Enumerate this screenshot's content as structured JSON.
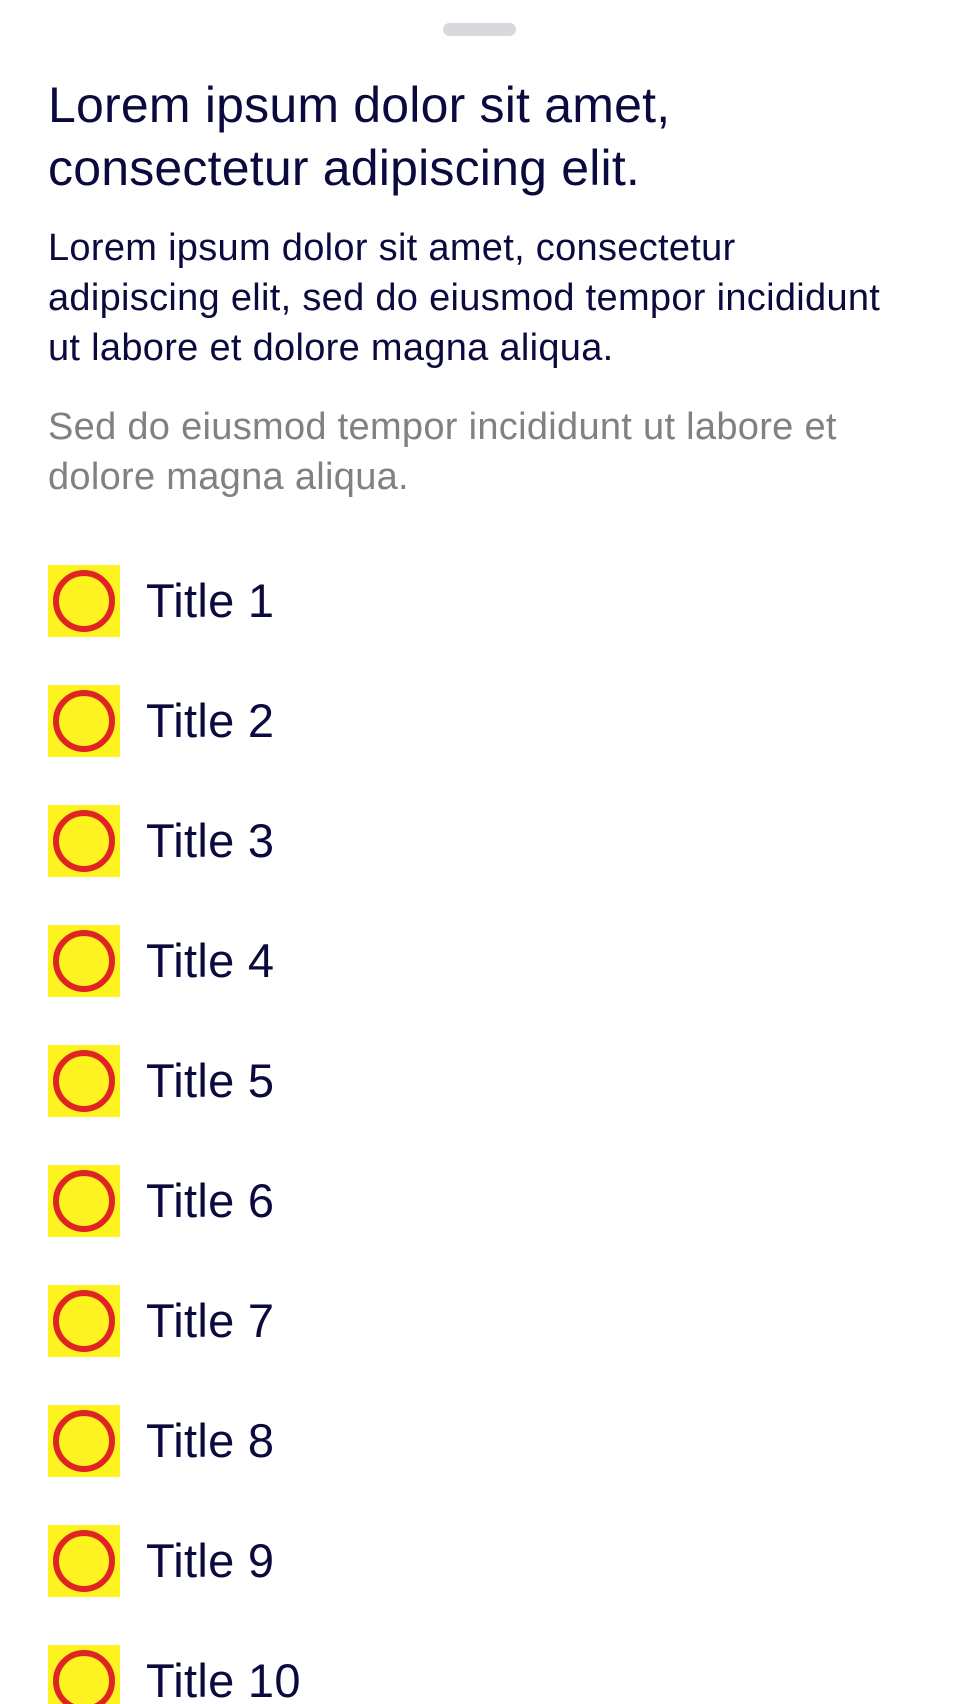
{
  "header": {
    "title": "Lorem ipsum dolor sit amet, consectetur adipiscing elit.",
    "body": "Lorem ipsum dolor sit amet, consectetur adipiscing elit, sed do eiusmod tempor incididunt ut labore et dolore magna aliqua.",
    "secondary": "Sed do eiusmod tempor incididunt ut labore et dolore magna aliqua."
  },
  "list": {
    "icon": "circle-outline-icon",
    "icon_background": "#fcf320",
    "icon_stroke": "#e02424",
    "items": [
      {
        "title": "Title 1"
      },
      {
        "title": "Title 2"
      },
      {
        "title": "Title 3"
      },
      {
        "title": "Title 4"
      },
      {
        "title": "Title 5"
      },
      {
        "title": "Title 6"
      },
      {
        "title": "Title 7"
      },
      {
        "title": "Title 8"
      },
      {
        "title": "Title 9"
      },
      {
        "title": "Title 10"
      }
    ]
  }
}
